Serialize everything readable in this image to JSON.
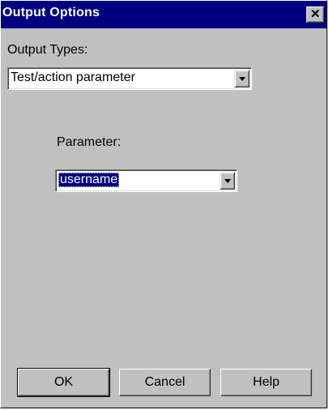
{
  "dialog": {
    "title": "Output Options",
    "close_glyph": "✕",
    "close_icon": "close-icon"
  },
  "output_types": {
    "label": "Output Types:",
    "selected_value": "Test/action parameter"
  },
  "parameter": {
    "label": "Parameter:",
    "selected_value": "username"
  },
  "buttons": {
    "ok": "OK",
    "cancel": "Cancel",
    "help": "Help"
  },
  "colors": {
    "titlebar": "#000080",
    "dialog_bg": "#c0c0c0",
    "selection": "#000080"
  }
}
